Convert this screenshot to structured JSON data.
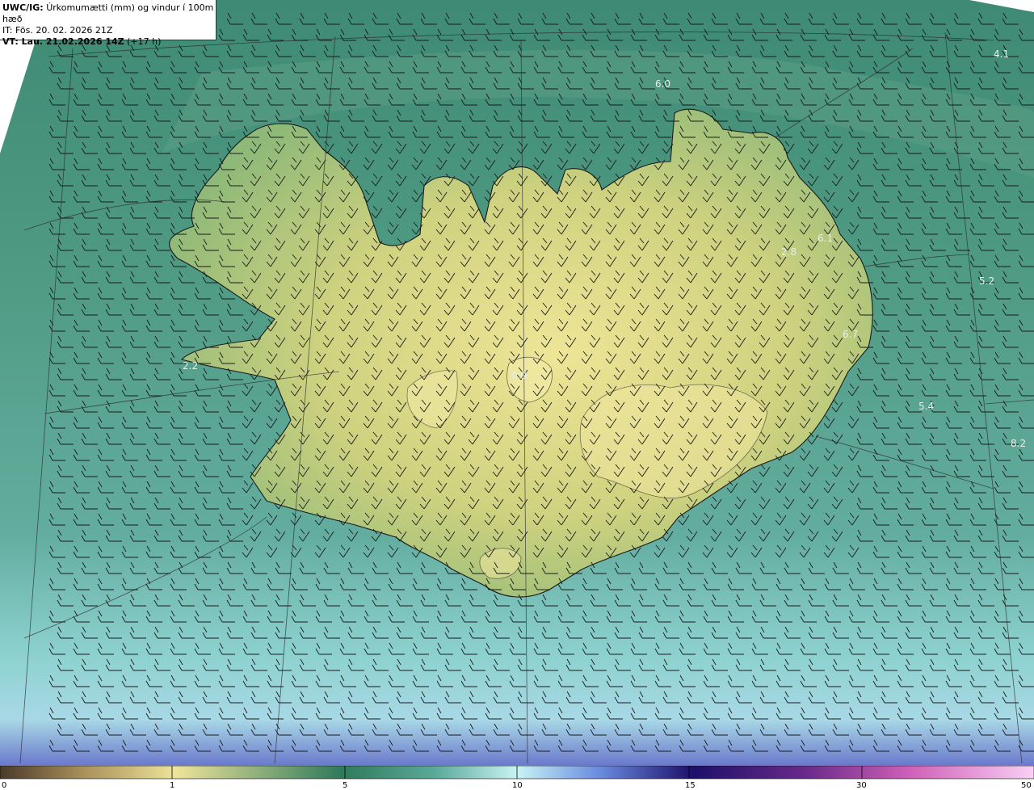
{
  "header": {
    "model_prefix": "UWC/IG:",
    "title": "Úrkomumætti (mm) og vindur í 100m hæð",
    "issue_time": "IT: Fös. 20. 02. 2026 21Z",
    "valid_prefix": "VT: Lau. 21.02.2026 14Z",
    "valid_suffix": " (+17 h)"
  },
  "map_labels": [
    {
      "text": "4.1"
    },
    {
      "text": "6.0"
    },
    {
      "text": "6.1"
    },
    {
      "text": "2.8"
    },
    {
      "text": "5.2"
    },
    {
      "text": "6.7"
    },
    {
      "text": "5.4"
    },
    {
      "text": "8.2"
    },
    {
      "text": "2.2"
    },
    {
      "text": "0.9"
    }
  ],
  "colorbar": {
    "ticks": [
      "0",
      "1",
      "5",
      "10",
      "15",
      "30",
      "50"
    ],
    "tick_values": [
      0,
      1,
      5,
      10,
      15,
      30,
      50
    ],
    "colors": [
      "#5a4630",
      "#b49a5a",
      "#e8e08a",
      "#3f8a6c",
      "#5fb2a0",
      "#c8f0f0",
      "#2c2c9a",
      "#2a0a6a",
      "#8a2a9a",
      "#e070c0",
      "#f8c8f0"
    ]
  },
  "theme": {
    "land_color": "#d9d585",
    "sea_color": "#4f9784",
    "south_sea_color": "#7dc3c3",
    "deep_color": "#6a6fc8"
  }
}
